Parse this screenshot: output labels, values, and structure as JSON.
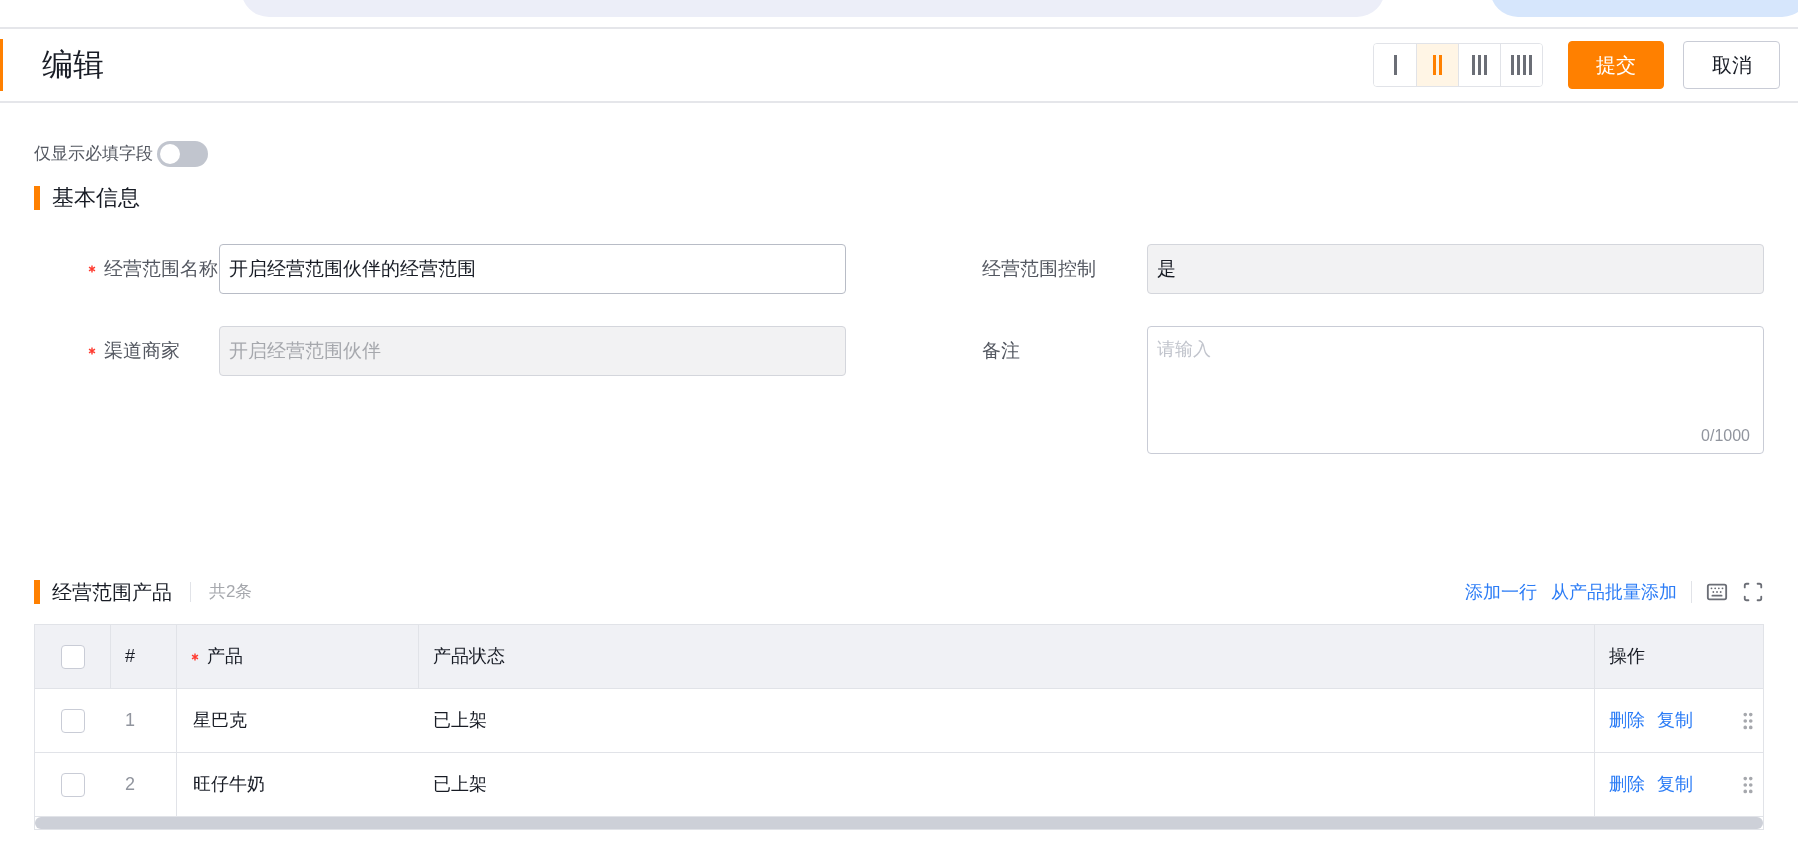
{
  "header": {
    "title": "编辑",
    "column_options": [
      {
        "selected": false
      },
      {
        "selected": true
      },
      {
        "selected": false
      },
      {
        "selected": false
      }
    ],
    "buttons": [
      {
        "label": "提交",
        "kind": "primary"
      },
      {
        "label": "取消",
        "kind": "default"
      }
    ]
  },
  "required_only": {
    "label": "仅显示必填字段",
    "on": false
  },
  "basic_section": {
    "title": "基本信息",
    "fields": [
      {
        "label": "经营范围名称",
        "required": true,
        "value": "开启经营范围伙伴的经营范围",
        "readonly": false,
        "disabled": false,
        "kind": "input"
      },
      {
        "label": "经营范围控制",
        "required": false,
        "value": "是",
        "readonly": true,
        "disabled": false,
        "kind": "input"
      },
      {
        "label": "渠道商家",
        "required": true,
        "value": "开启经营范围伙伴",
        "readonly": true,
        "disabled": true,
        "kind": "input"
      },
      {
        "label": "备注",
        "required": false,
        "placeholder": "请输入",
        "counter": "0/1000",
        "kind": "textarea"
      }
    ]
  },
  "products_section": {
    "title": "经营范围产品",
    "count": "共2条",
    "actions": [
      "添加一行",
      "从产品批量添加"
    ],
    "table": {
      "header_checked": false,
      "columns": [
        {
          "label": "#",
          "required": false
        },
        {
          "label": "产品",
          "required": true
        },
        {
          "label": "产品状态",
          "required": false
        },
        {
          "label": "操作",
          "required": false
        }
      ],
      "rows": [
        {
          "checked": false,
          "index": "1",
          "product": "星巴克",
          "status": "已上架",
          "actions": [
            "删除",
            "复制"
          ]
        },
        {
          "checked": false,
          "index": "2",
          "product": "旺仔牛奶",
          "status": "已上架",
          "actions": [
            "删除",
            "复制"
          ]
        }
      ]
    }
  }
}
